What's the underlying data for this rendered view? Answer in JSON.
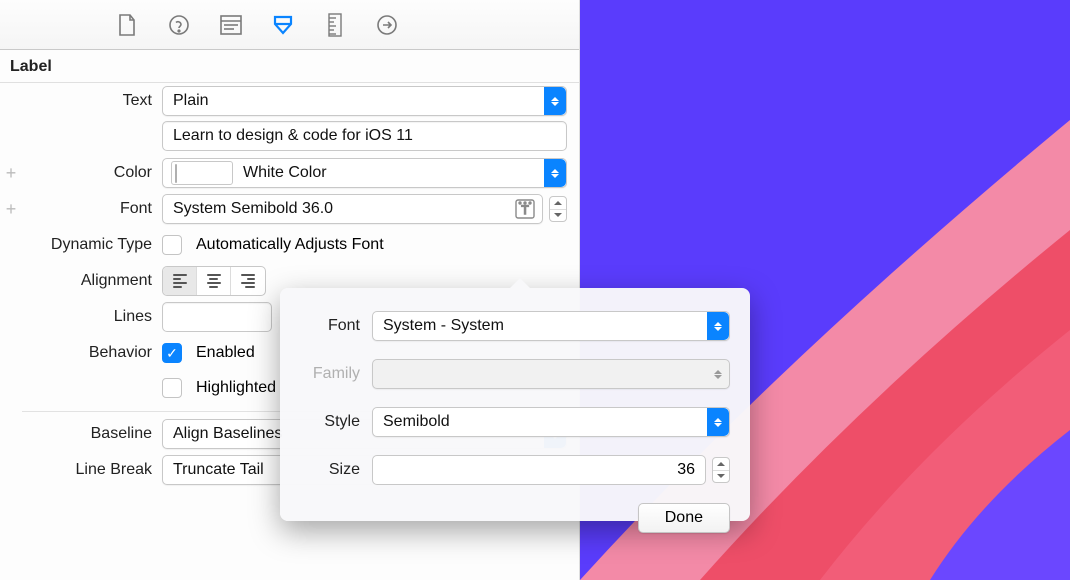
{
  "section": {
    "title": "Label"
  },
  "rows": {
    "text_label": "Text",
    "text_style": "Plain",
    "text_value": "Learn to design & code for iOS 11",
    "color_label": "Color",
    "color_name": "White Color",
    "font_label": "Font",
    "font_value": "System Semibold 36.0",
    "dynamic_label": "Dynamic Type",
    "dynamic_check": "Automatically Adjusts Font",
    "alignment_label": "Alignment",
    "lines_label": "Lines",
    "lines_value": "",
    "behavior_label": "Behavior",
    "behavior_enabled": "Enabled",
    "behavior_highlight": "Highlighted",
    "baseline_label": "Baseline",
    "baseline_value": "Align Baselines",
    "linebreak_label": "Line Break",
    "linebreak_value": "Truncate Tail"
  },
  "popover": {
    "font_label": "Font",
    "font_value": "System - System",
    "family_label": "Family",
    "family_value": "",
    "style_label": "Style",
    "style_value": "Semibold",
    "size_label": "Size",
    "size_value": "36",
    "done": "Done"
  }
}
